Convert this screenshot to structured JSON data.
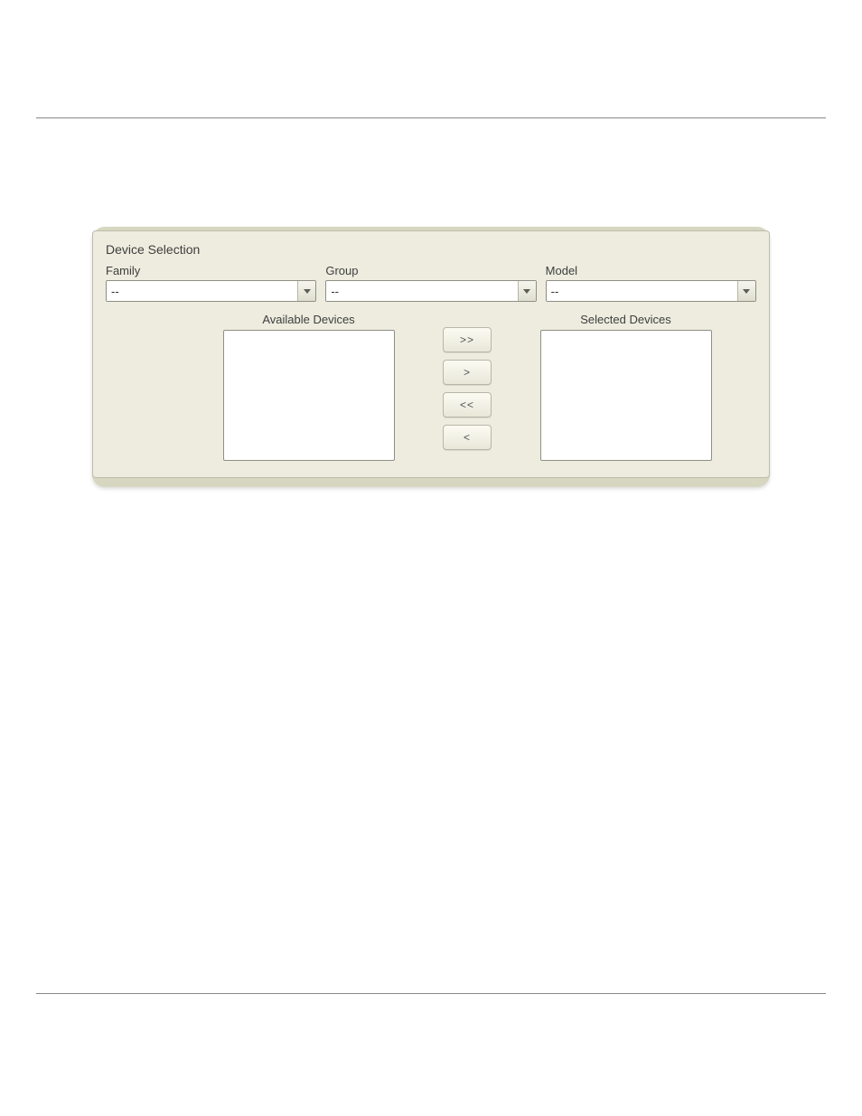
{
  "panel": {
    "title": "Device Selection",
    "filters": {
      "family": {
        "label": "Family",
        "value": "--"
      },
      "group": {
        "label": "Group",
        "value": "--"
      },
      "model": {
        "label": "Model",
        "value": "--"
      }
    },
    "lists": {
      "available_label": "Available Devices",
      "selected_label": "Selected Devices"
    },
    "buttons": {
      "add_all": ">>",
      "add_one": ">",
      "remove_all": "<<",
      "remove_one": "<"
    }
  }
}
